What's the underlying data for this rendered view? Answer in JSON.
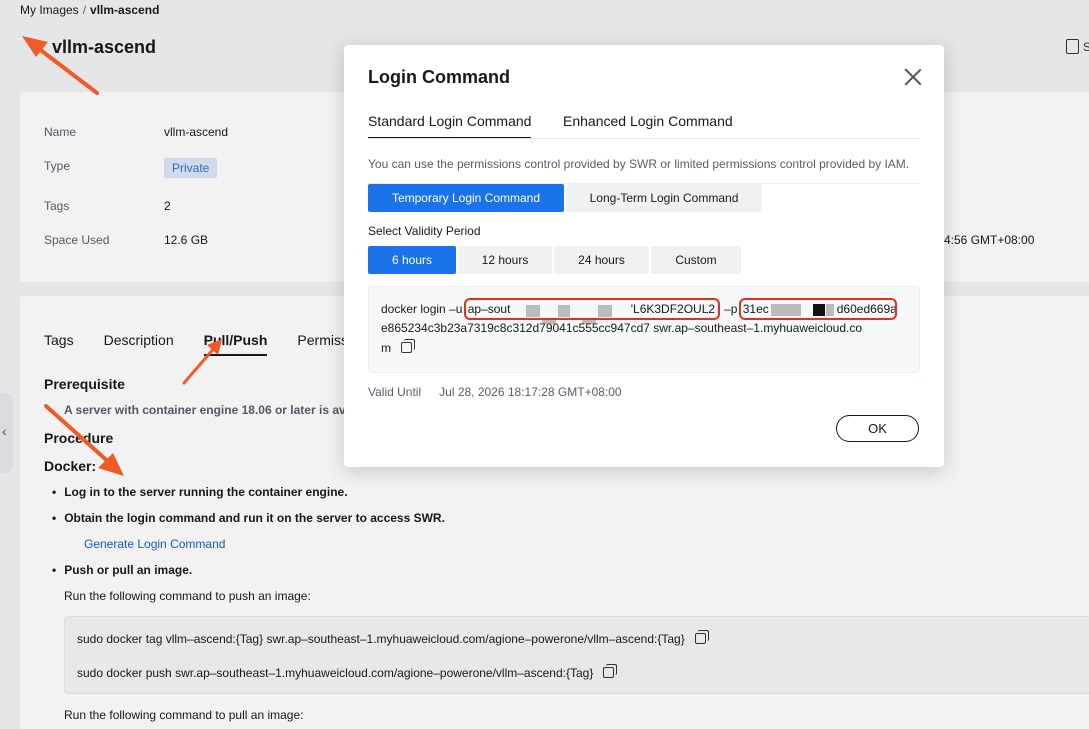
{
  "breadcrumb": {
    "parent": "My Images",
    "separator": "/",
    "current": "vllm-ascend"
  },
  "page": {
    "title": "vllm-ascend",
    "top_right_fragment": "S"
  },
  "info": {
    "rows": [
      {
        "label": "Name",
        "value": "vllm-ascend"
      },
      {
        "label": "Type",
        "value": "Private"
      },
      {
        "label": "Tags",
        "value": "2"
      },
      {
        "label": "Space Used",
        "value": "12.6 GB"
      }
    ],
    "right_fragment": "4:56 GMT+08:00"
  },
  "detail_tabs": [
    "Tags",
    "Description",
    "Pull/Push",
    "Permiss"
  ],
  "content": {
    "prerequisite_title": "Prerequisite",
    "prerequisite_text": "A server with container engine 18.06 or later is av",
    "procedure_title": "Procedure",
    "docker_title": "Docker:",
    "bullets": [
      "Log in to the server running the container engine.",
      "Obtain the login command and run it on the server to access SWR.",
      "Push or pull an image."
    ],
    "generate_link": "Generate Login Command",
    "push_intro": "Run the following command to push an image:",
    "push_commands": [
      "sudo docker tag vllm–ascend:{Tag} swr.ap–southeast–1.myhuaweicloud.com/agione–powerone/vllm–ascend:{Tag}",
      "sudo docker push swr.ap–southeast–1.myhuaweicloud.com/agione–powerone/vllm–ascend:{Tag}"
    ],
    "pull_intro": "Run the following command to pull an image:"
  },
  "modal": {
    "title": "Login Command",
    "tabs": [
      "Standard Login Command",
      "Enhanced Login Command"
    ],
    "description": "You can use the permissions control provided by SWR or limited permissions control provided by IAM.",
    "command_types": [
      "Temporary Login Command",
      "Long-Term Login Command"
    ],
    "validity_label": "Select Validity Period",
    "validity_options": [
      "6 hours",
      "12 hours",
      "24 hours",
      "Custom"
    ],
    "command": {
      "prefix": "docker login –u ",
      "user_start": "ap–sout",
      "user_end": "'L6K3DF2OUL2",
      "p_flag": " –p ",
      "pw_start": "31ec",
      "pw_end": "d60ed669a",
      "line2": "e865234c3b23a7319c8c312d79041c555cc947cd7 swr.ap–southeast–1.myhuaweicloud.co",
      "line3": "m"
    },
    "valid_until_label": "Valid Until",
    "valid_until_value": "Jul 28, 2026 18:17:28 GMT+08:00",
    "ok_label": "OK"
  },
  "colors": {
    "accent": "#1a73e8",
    "annotation": "#f05a28",
    "redaction_box": "#e0301e"
  }
}
